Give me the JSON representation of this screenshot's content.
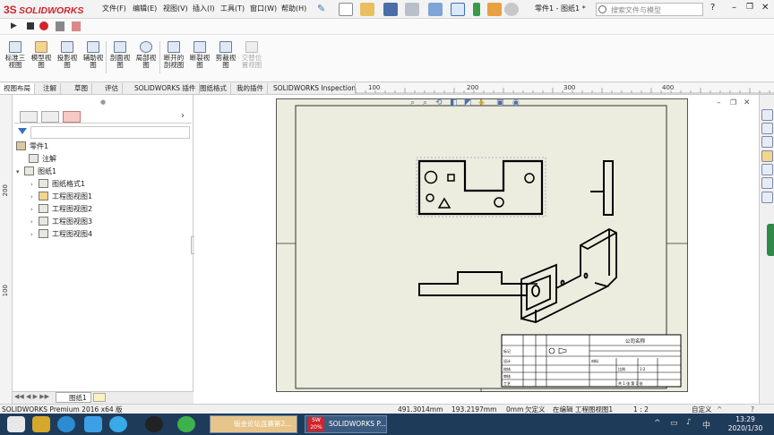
{
  "app": {
    "logo_text": "SOLIDWORKS",
    "document_title": "零件1 - 图纸1 *"
  },
  "menu": [
    "文件(F)",
    "编辑(E)",
    "视图(V)",
    "插入(I)",
    "工具(T)",
    "窗口(W)",
    "帮助(H)"
  ],
  "search": {
    "placeholder": "搜索文件与模型"
  },
  "ribbon": {
    "buttons": [
      {
        "label": "标准三视图",
        "name": "standard-3-view"
      },
      {
        "label": "模型视图",
        "name": "model-view"
      },
      {
        "label": "投影视图",
        "name": "projected-view"
      },
      {
        "label": "辅助视图",
        "name": "auxiliary-view"
      },
      {
        "label": "剖面视图",
        "name": "section-view"
      },
      {
        "label": "局部视图",
        "name": "detail-view"
      },
      {
        "label": "断开的剖视图",
        "name": "broken-out-section"
      },
      {
        "label": "断裂视图",
        "name": "break-view"
      },
      {
        "label": "剪裁视图",
        "name": "crop-view"
      },
      {
        "label": "交替位置视图",
        "name": "alternate-position-view"
      }
    ]
  },
  "tabs": [
    "视图布局",
    "注解",
    "草图",
    "评估",
    "SOLIDWORKS 插件",
    "图纸格式",
    "我的插件",
    "SOLIDWORKS Inspection"
  ],
  "ruler": {
    "top": [
      "100",
      "200",
      "300",
      "400"
    ],
    "left": [
      "200",
      "100"
    ]
  },
  "tree": {
    "root": "零件1",
    "items": [
      {
        "label": "注解",
        "indent": 1
      },
      {
        "label": "图纸1",
        "indent": 1
      },
      {
        "label": "图纸格式1",
        "indent": 2
      },
      {
        "label": "工程图视图1",
        "indent": 2
      },
      {
        "label": "工程图视图2",
        "indent": 2
      },
      {
        "label": "工程图视图3",
        "indent": 2
      },
      {
        "label": "工程图视图4",
        "indent": 2
      }
    ]
  },
  "sheet_tab": "图纸1",
  "title_block": {
    "company": "公司名称",
    "rows": [
      "标记",
      "设计",
      "校核",
      "审核",
      "工艺",
      "批准"
    ],
    "material_label": "材料",
    "scale_label": "比例",
    "scale_value": "1:2",
    "sheet_count": "共 1 张 第 1 张"
  },
  "status": {
    "product": "SOLIDWORKS Premium 2016 x64 版",
    "x": "491.3014mm",
    "y": "193.2197mm",
    "z": "0mm",
    "state": "欠定义",
    "editing": "在编辑 工程图视图1",
    "scale": "1 : 2",
    "units": "自定义"
  },
  "taskbar": {
    "apps": [
      "钣金论坛连赛第2...",
      "SOLIDWORKS P..."
    ],
    "badge": "20%",
    "time": "13:29",
    "date": "2020/1/30"
  }
}
